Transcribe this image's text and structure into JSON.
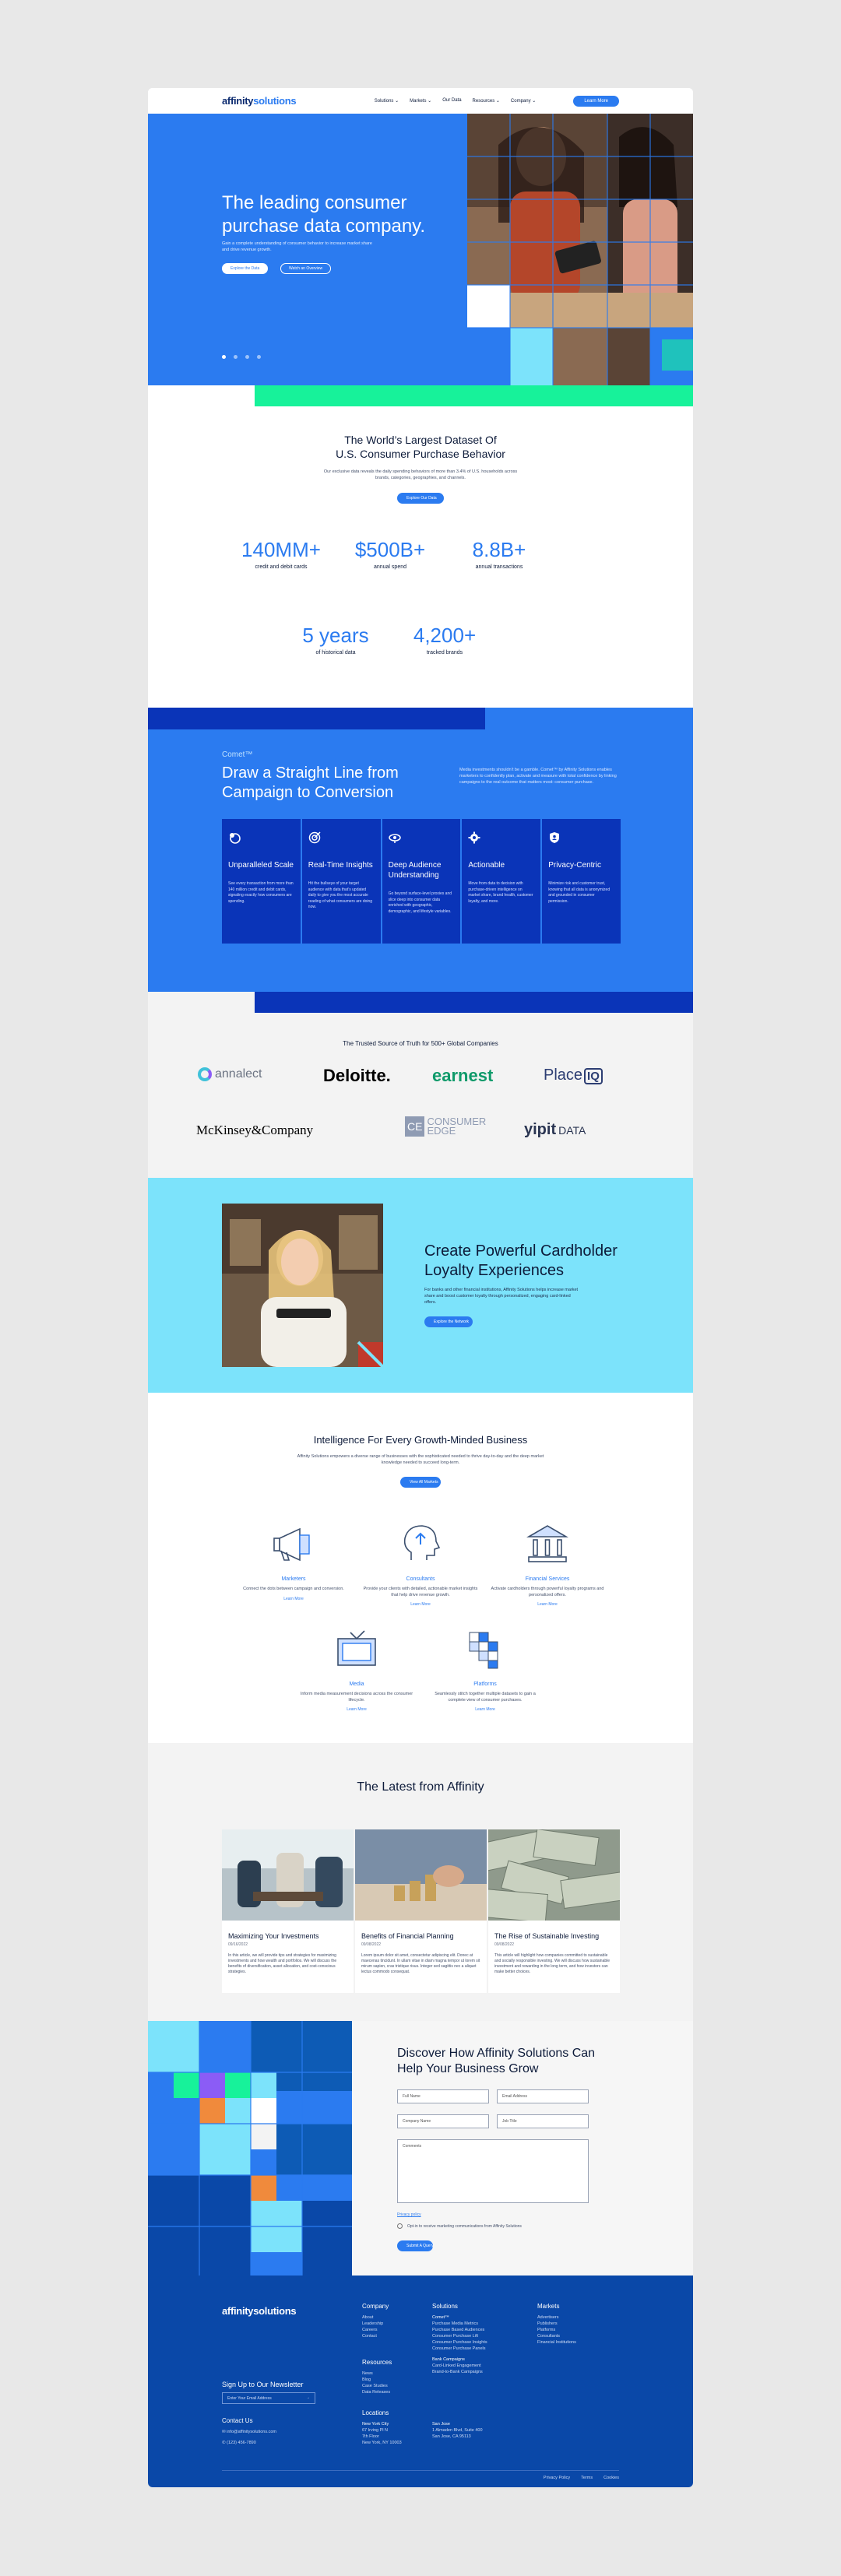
{
  "nav": {
    "logo_a": "affinity",
    "logo_b": "solutions",
    "items": [
      "Solutions",
      "Markets",
      "Our Data",
      "Resources",
      "Company"
    ],
    "cta": "Learn More"
  },
  "hero": {
    "title": "The leading consumer purchase data company.",
    "subtitle": "Gain a complete understanding of consumer behavior to increase market share and drive revenue growth.",
    "btn_primary": "Explore the Data",
    "btn_secondary": "Watch an Overview",
    "slide_count": 4,
    "active_slide": 1
  },
  "dataset": {
    "title_line1": "The World’s Largest Dataset Of",
    "title_line2": "U.S. Consumer Purchase Behavior",
    "subtitle": "Our exclusive data reveals the daily spending behaviors of more than 3.4% of U.S. households across brands, categories, geographies, and channels.",
    "cta": "Explore Our Data",
    "stats": [
      {
        "num": "140MM+",
        "label": "credit and debit cards"
      },
      {
        "num": "$500B+",
        "label": "annual spend"
      },
      {
        "num": "8.8B+",
        "label": "annual transactions"
      },
      {
        "num": "5 years",
        "label": "of historical data"
      },
      {
        "num": "4,200+",
        "label": "tracked brands"
      }
    ]
  },
  "comet": {
    "kicker": "Comet™",
    "title": "Draw a Straight Line from Campaign to Conversion",
    "desc": "Media investments shouldn’t be a gamble. Comet™ by Affinity Solutions enables marketers to confidently plan, activate and measure with total confidence by linking campaigns to the real outcome that matters most: consumer purchase.",
    "cards": [
      {
        "title": "Unparalleled Scale",
        "text": "See every transaction from more than 140 million credit and debit cards, signaling exactly how consumers are spending."
      },
      {
        "title": "Real-Time Insights",
        "text": "Hit the bullseye of your target audience with data that’s updated daily to give you the most accurate reading of what consumers are doing now."
      },
      {
        "title": "Deep Audience Understanding",
        "text": "Go beyond surface-level proxies and slice deep into consumer data enriched with geographic, demographic, and lifestyle variables."
      },
      {
        "title": "Actionable",
        "text": "Move from data to decision with purchase-driven intelligence on market share, brand health, customer loyalty, and more."
      },
      {
        "title": "Privacy-Centric",
        "text": "Minimize risk and customer trust, knowing that all data is anonymized and grounded in consumer permission."
      }
    ]
  },
  "logos": {
    "title": "The Trusted Source of Truth for 500+ Global Companies",
    "items": [
      "annalect",
      "Deloitte.",
      "earnest",
      "Place",
      "IQ",
      "McKinsey&Company",
      "CE",
      "CONSUMER",
      "EDGE",
      "yipit",
      "DATA"
    ]
  },
  "loyalty": {
    "title": "Create Powerful Cardholder Loyalty Experiences",
    "text": "For banks and other financial institutions, Affinity Solutions helps increase market share and boost customer loyalty through personalized, engaging card-linked offers.",
    "cta": "Explore the Network"
  },
  "intel": {
    "title": "Intelligence For Every Growth-Minded Business",
    "subtitle": "Affinity Solutions empowers a diverse range of businesses with the sophisticated needed to thrive day-to-day and the deep market knowledge needed to succeed long-term.",
    "cta": "View All Markets",
    "learn": "Learn More",
    "items": [
      {
        "title": "Marketers",
        "text": "Connect the dots between campaign and conversion."
      },
      {
        "title": "Consultants",
        "text": "Provide your clients with detailed, actionable market insights that help drive revenue growth."
      },
      {
        "title": "Financial Services",
        "text": "Activate cardholders through powerful loyalty programs and personalized offers."
      },
      {
        "title": "Media",
        "text": "Inform media measurement decisions across the consumer lifecycle."
      },
      {
        "title": "Platforms",
        "text": "Seamlessly stitch together multiple datasets to gain a complete view of consumer purchases."
      }
    ]
  },
  "latest": {
    "title": "The Latest from Affinity",
    "posts": [
      {
        "title": "Maximizing Your Investments",
        "date": "09/16/2022",
        "text": "In this article, we will provide tips and strategies for maximizing investments and how wealth and portfolios. We will discuss the benefits of diversification, asset allocation, and cost-conscious strategies."
      },
      {
        "title": "Benefits of Financial Planning",
        "date": "09/08/2022",
        "text": "Lorem ipsum dolor sit amet, consectetur adipiscing elit. Donec at maecenas tincidunt. In ullam vitae in diam magna tempor ut lorem sit mirum sapien, cras tristique risus. Integer sed sagittis nec a aliquet lectus commodo consequat."
      },
      {
        "title": "The Rise of Sustainable Investing",
        "date": "09/08/2022",
        "text": "This article will highlight how companies committed to sustainable and socially responsible investing. We will discuss how sustainable investment and rewarding in the long term, and how investors can make better choices."
      }
    ]
  },
  "contact": {
    "title": "Discover How Affinity Solutions Can Help Your Business Grow",
    "fields": [
      "Full Name",
      "Email Address",
      "Company Name",
      "Job Title",
      "Comments"
    ],
    "privacy": "Privacy policy",
    "consent": "Opt-in to receive marketing communications from Affinity Solutions",
    "submit": "Submit A Query"
  },
  "footer": {
    "logo_a": "affinity",
    "logo_b": "solutions",
    "company_h": "Company",
    "company": [
      "About",
      "Leadership",
      "Careers",
      "Contact"
    ],
    "solutions_h": "Solutions",
    "solutions_comet": "Comet™",
    "solutions": [
      "Purchase Media Metrics",
      "Purchase Based Audiences",
      "Consumer Purchase Lift",
      "Consumer Purchase Insights",
      "Consumer Purchase Panels"
    ],
    "bank_h": "Bank Campaigns",
    "bank": [
      "Card-Linked Engagement",
      "Brand-to-Bank Campaigns"
    ],
    "markets_h": "Markets",
    "markets": [
      "Advertisers",
      "Publishers",
      "Platforms",
      "Consultants",
      "Financial Institutions"
    ],
    "resources_h": "Resources",
    "resources": [
      "News",
      "Blog",
      "Case Studies",
      "Data Releases"
    ],
    "newsletter_h": "Sign Up to Our Newsletter",
    "newsletter_ph": "Enter Your Email Address",
    "contact_h": "Contact Us",
    "email": "info@affinitysolutions.com",
    "phone": "(123) 456-7890",
    "locations_h": "Locations",
    "ny_h": "New York City",
    "ny": [
      "67 Irving Pl N",
      "7th Floor",
      "New York, NY 10003"
    ],
    "sj_h": "San Jose",
    "sj": [
      "1 Almaden Blvd, Suite 400",
      "San Jose, CA 95113"
    ],
    "legal": [
      "Privacy Policy",
      "Terms",
      "Cookies"
    ]
  },
  "colors": {
    "blue": "#2b7bf0",
    "navy": "#0a34b8",
    "green": "#17f29a",
    "cyan": "#7ce3fb",
    "footer": "#0a48a8"
  }
}
